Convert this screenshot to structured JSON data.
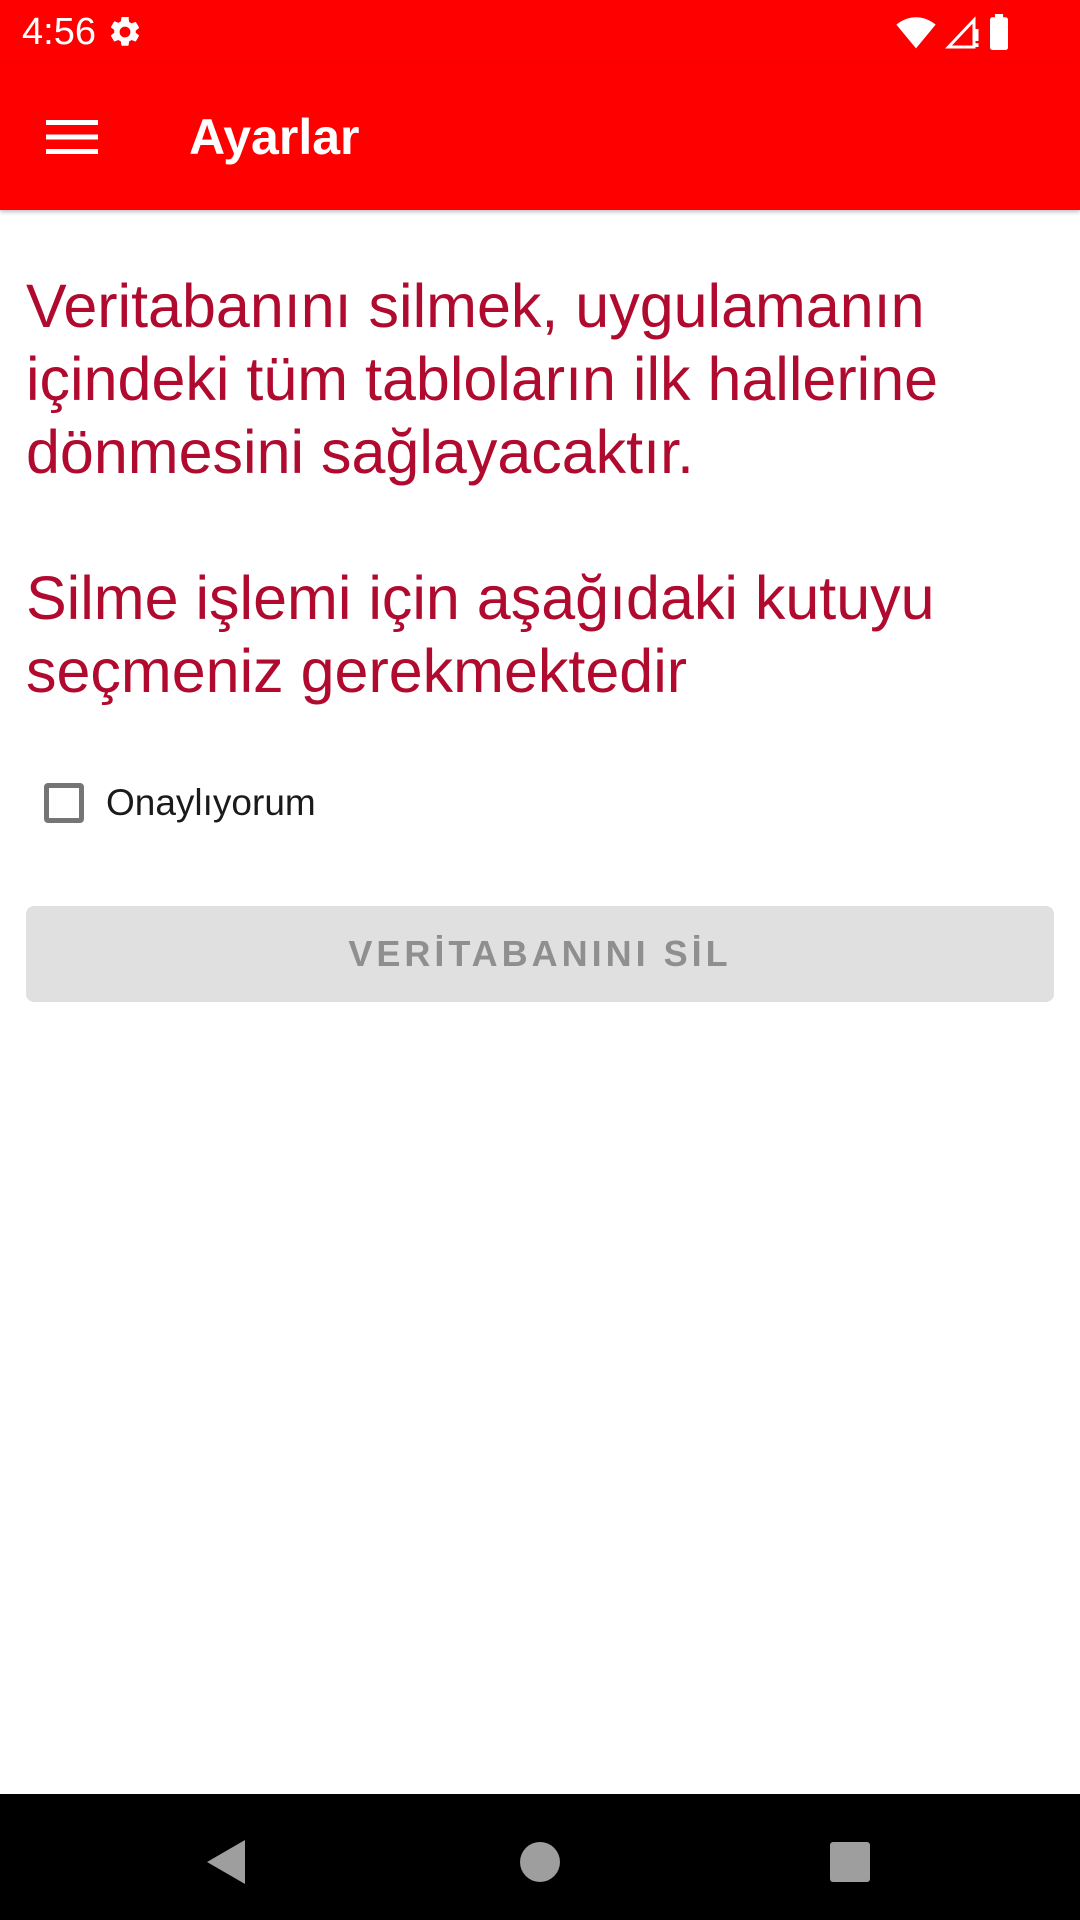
{
  "status_bar": {
    "time": "4:56",
    "icons": [
      "gear-icon",
      "wifi-icon",
      "signal-icon",
      "battery-icon"
    ]
  },
  "app_bar": {
    "title": "Ayarlar",
    "menu_icon": "hamburger-menu-icon"
  },
  "content": {
    "message_1": "Veritabanını silmek, uygulamanın içindeki tüm tabloların ilk hallerine dönmesini sağlayacaktır.",
    "message_2": "Silme işlemi için aşağıdaki kutuyu seçmeniz gerekmektedir",
    "checkbox_label": "Onaylıyorum",
    "checkbox_checked": false,
    "delete_button_label": "VERİTABANINI SİL",
    "delete_button_enabled": false
  },
  "nav_bar": {
    "icons": [
      "back-icon",
      "home-icon",
      "recents-icon"
    ]
  },
  "colors": {
    "primary": "#ff0000",
    "message_text": "#b00a2f",
    "disabled_button": "#e0e0e0",
    "disabled_text": "#8f8f8f"
  }
}
